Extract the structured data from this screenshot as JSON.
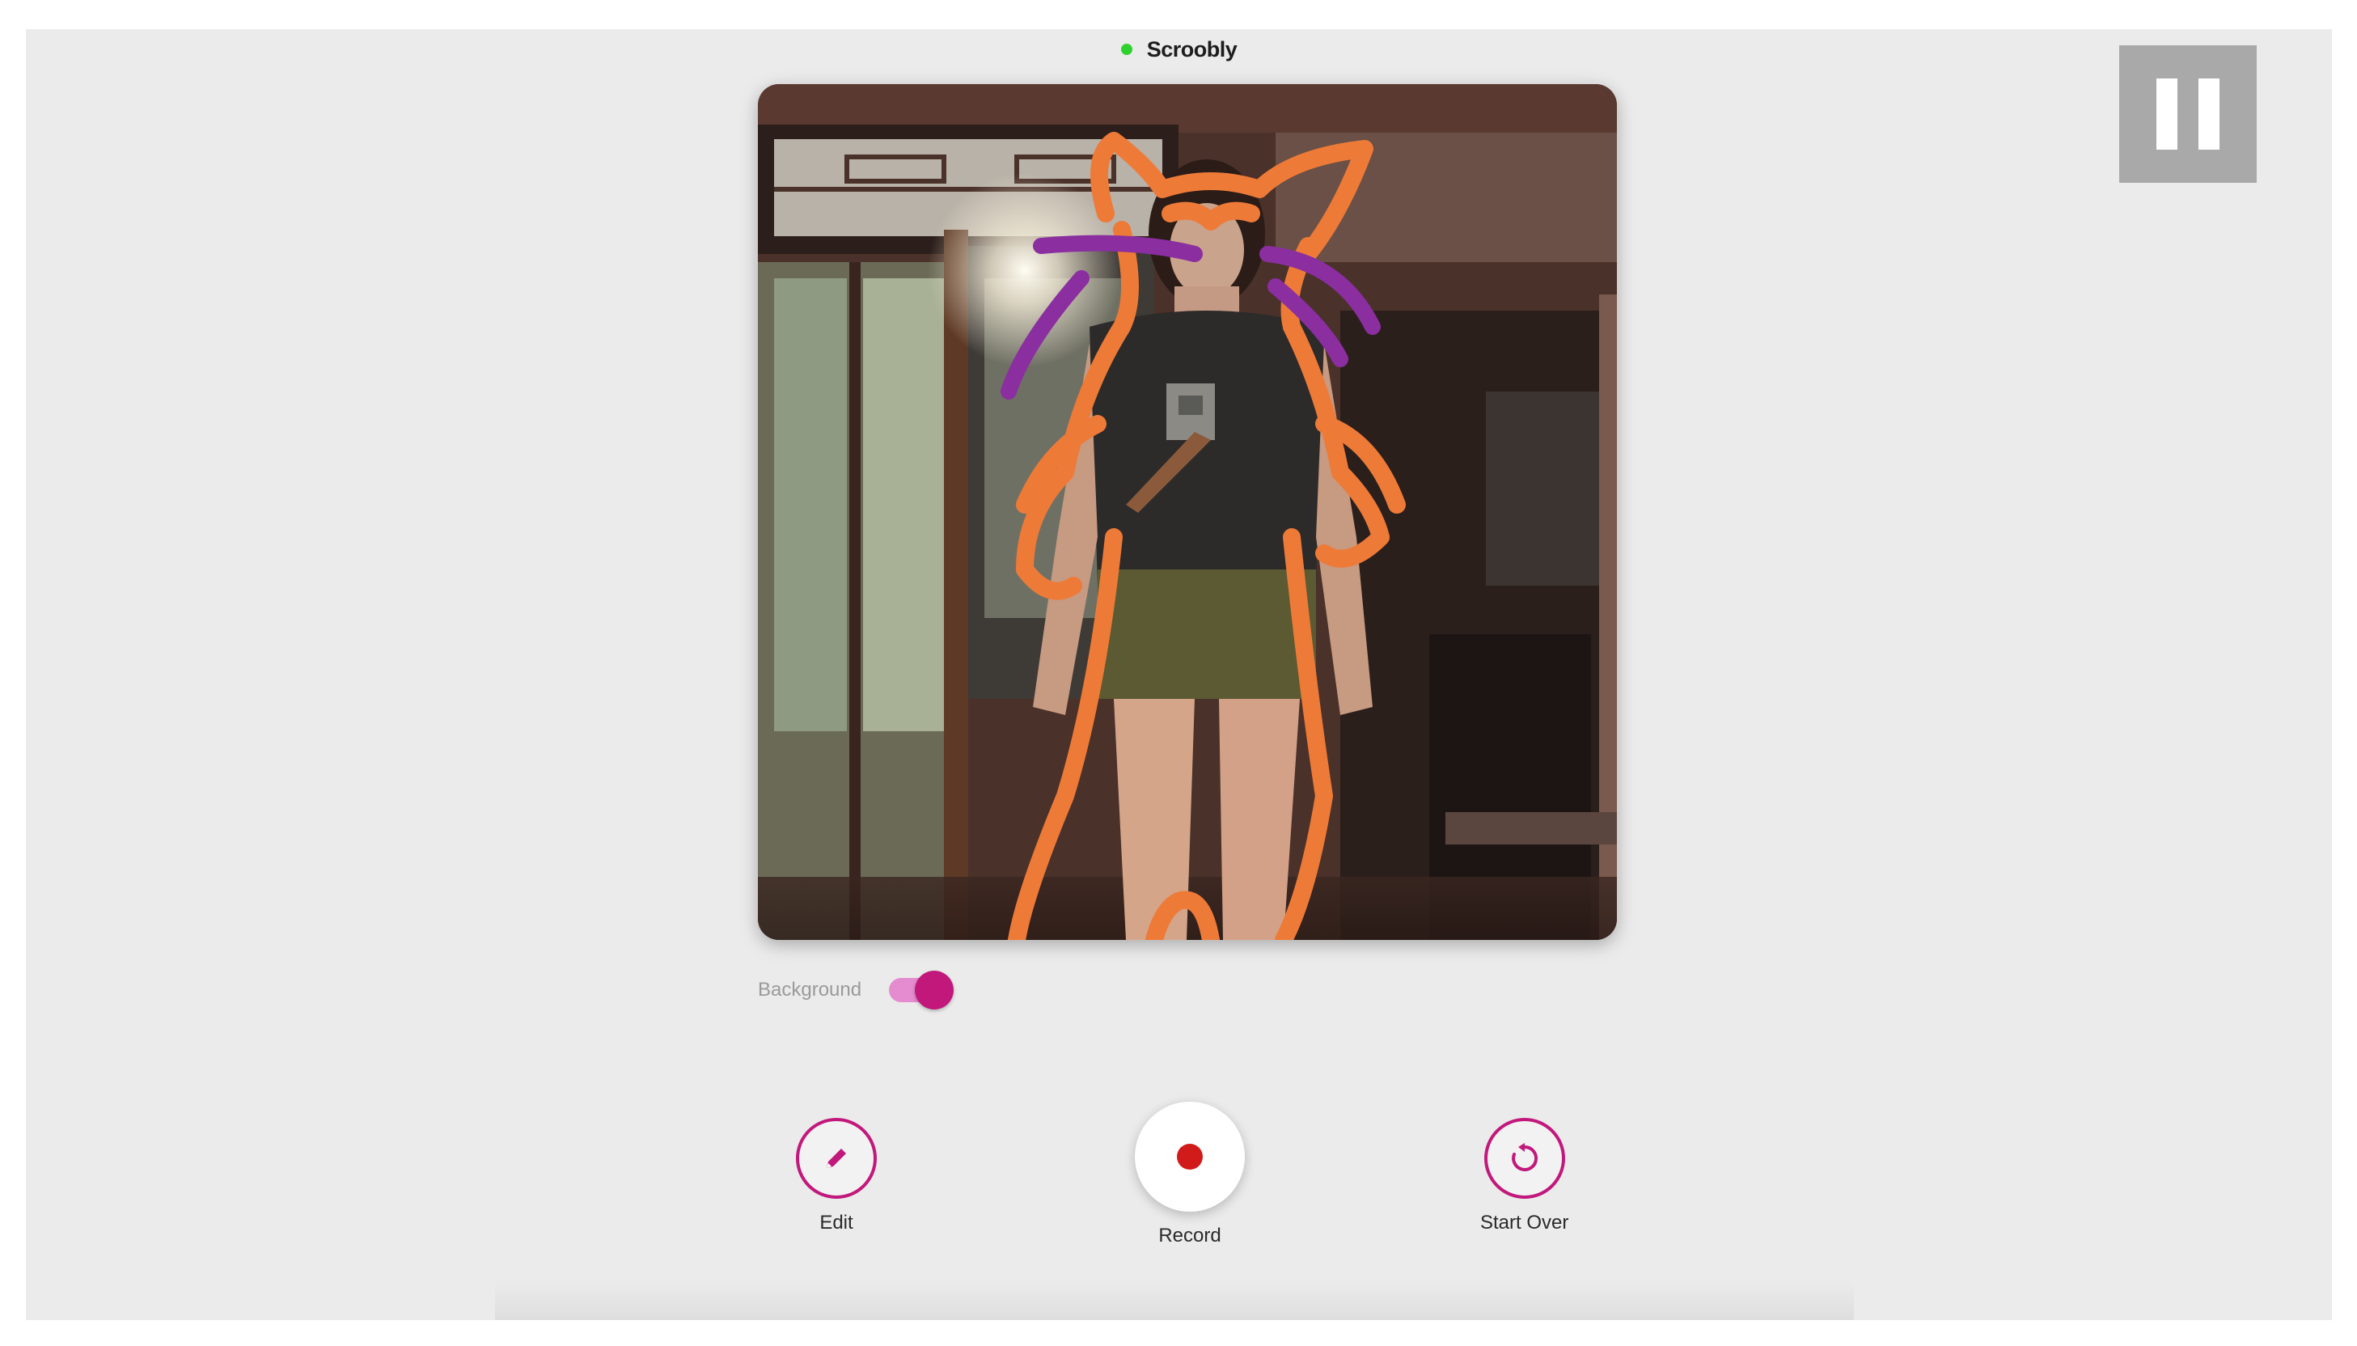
{
  "app": {
    "title": "Scroobly",
    "status_color": "#2fd12f",
    "accent_color": "#c2187c"
  },
  "viewport": {
    "content": "webcam feed of a person with orange cat doodle overlay"
  },
  "background_toggle": {
    "label": "Background",
    "state": "on"
  },
  "controls": {
    "edit_label": "Edit",
    "record_label": "Record",
    "start_over_label": "Start Over"
  },
  "icons": {
    "edit": "pencil-icon",
    "record": "record-dot-icon",
    "start_over": "restart-icon",
    "pause": "pause-icon"
  },
  "overlay": {
    "pause_state": "playing"
  }
}
